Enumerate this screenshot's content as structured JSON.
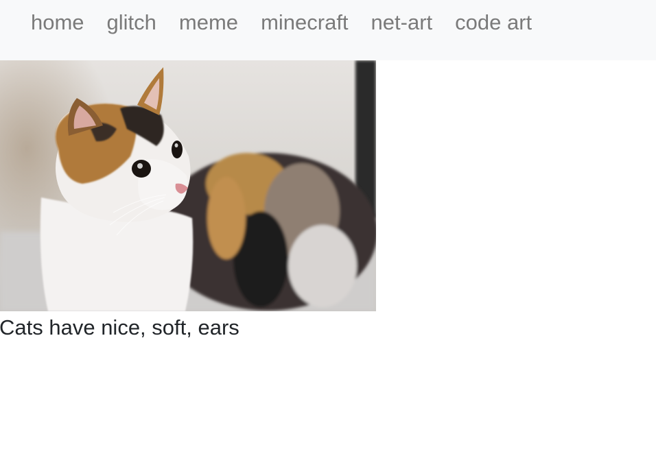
{
  "nav": {
    "items": [
      {
        "label": "home"
      },
      {
        "label": "glitch"
      },
      {
        "label": "meme"
      },
      {
        "label": "minecraft"
      },
      {
        "label": "net-art"
      },
      {
        "label": "code art"
      }
    ]
  },
  "main": {
    "image": {
      "icon": "calico-cat-photo",
      "alt": ""
    },
    "caption": "Cats have nice, soft, ears"
  },
  "colors": {
    "navbar_bg": "#f8f9fa",
    "nav_link": "#7a7a7a",
    "caption_text": "#212529"
  }
}
